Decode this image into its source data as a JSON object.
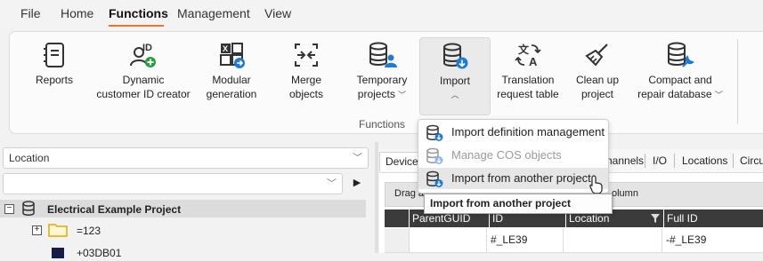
{
  "menu": {
    "file": "File",
    "home": "Home",
    "functions": "Functions",
    "management": "Management",
    "view": "View",
    "accent": "#e8742a"
  },
  "ribbon": {
    "reports": "Reports",
    "dynamic_id_line1": "Dynamic",
    "dynamic_id_line2": "customer ID creator",
    "modular_line1": "Modular",
    "modular_line2": "generation",
    "merge_line1": "Merge",
    "merge_line2": "objects",
    "temp_line1": "Temporary",
    "temp_line2": "projects",
    "import": "Import",
    "translation_line1": "Translation",
    "translation_line2": "request table",
    "cleanup_line1": "Clean up",
    "cleanup_line2": "project",
    "compact_line1": "Compact and",
    "compact_line2": "repair database",
    "group_label": "Functions",
    "chevron_down": "﹀",
    "chevron_up": "︿"
  },
  "left_panel": {
    "location_combo": "Location",
    "combo_arrow": "﹀",
    "filter_combo": "",
    "nav_arrow": "▶",
    "tree": [
      {
        "label": "Electrical Example Project",
        "expander": "−"
      },
      {
        "label": "=123",
        "expander": "+"
      },
      {
        "label": "+03DB01",
        "expander": ""
      }
    ]
  },
  "right_panel": {
    "tabs": [
      "Devices",
      "hannels",
      "I/O",
      "Locations",
      "Circu"
    ],
    "group_hint_prefix": "Drag a",
    "group_hint_suffix": "olumn",
    "columns": [
      "ParentGUID",
      "ID",
      "Location",
      "Full ID"
    ],
    "row": [
      "",
      "#_LE39",
      "",
      "-#_LE39"
    ]
  },
  "import_menu": {
    "items": [
      {
        "label": "Import definition management",
        "enabled": true
      },
      {
        "label": "Manage COS objects",
        "enabled": false
      },
      {
        "label": "Import from another project",
        "enabled": true
      }
    ],
    "tooltip": "Import from another project"
  }
}
